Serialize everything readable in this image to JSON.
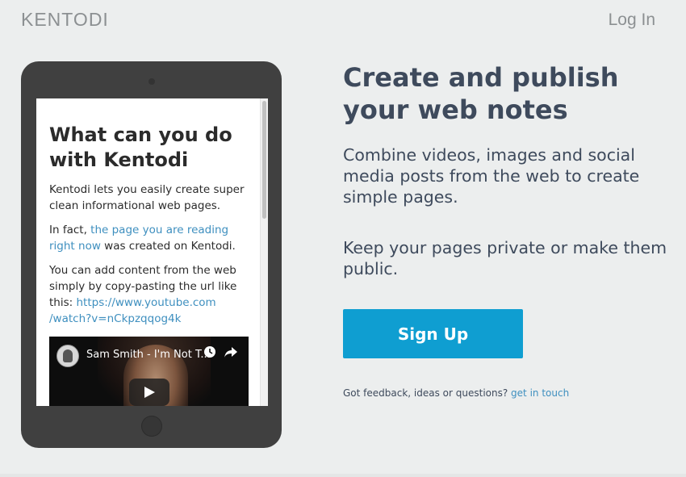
{
  "header": {
    "logo": "KENTODI",
    "login_label": "Log In"
  },
  "tablet": {
    "title": "What can you do with Kentodi",
    "para1": "Kentodi lets you easily create super clean informational web pages.",
    "para2_prefix": "In fact, ",
    "para2_link": "the page you are reading right now",
    "para2_suffix": " was created on Kentodi.",
    "para3_prefix": "You can add content from the web simply by copy-pasting the url like this: ",
    "para3_link_line1": "https://www.youtube.com",
    "para3_link_line2": "/watch?v=nCkpzqqog4k",
    "video": {
      "title": "Sam Smith - I'm Not T...",
      "icons": [
        "clock-icon",
        "share-icon",
        "play-icon"
      ]
    }
  },
  "hero": {
    "headline": "Create and publish your web notes",
    "description1": "Combine videos, images and social media posts from the web to create simple pages.",
    "description2": "Keep your pages private or make them public.",
    "signup_label": "Sign Up",
    "feedback_text": "Got feedback, ideas or questions? ",
    "feedback_link": "get in touch"
  },
  "colors": {
    "background": "#eceeee",
    "accent": "#0f9ed1",
    "text": "#3e4a5c",
    "link": "#3e8fbf",
    "tablet": "#404040"
  }
}
